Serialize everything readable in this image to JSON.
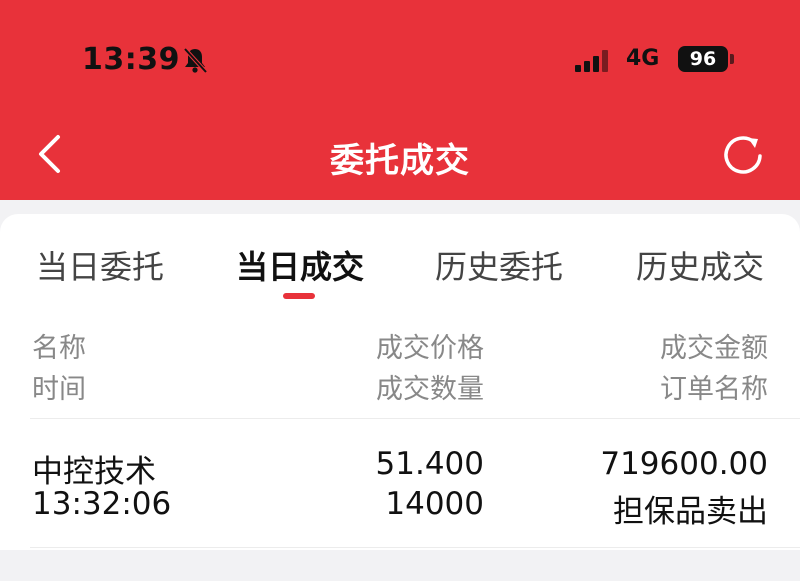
{
  "status_bar": {
    "time": "13:39",
    "network": "4G",
    "battery": "96",
    "icons": [
      "bell-slash-icon",
      "cellular-signal-icon",
      "battery-icon"
    ]
  },
  "nav": {
    "title": "委托成交",
    "icons": [
      "chevron-left-icon",
      "refresh-icon"
    ]
  },
  "tabs": [
    {
      "label": "当日委托",
      "active": false
    },
    {
      "label": "当日成交",
      "active": true
    },
    {
      "label": "历史委托",
      "active": false
    },
    {
      "label": "历史成交",
      "active": false
    }
  ],
  "table": {
    "headers": {
      "col1": [
        "名称",
        "时间"
      ],
      "col2": [
        "成交价格",
        "成交数量"
      ],
      "col3": [
        "成交金额",
        "订单名称"
      ]
    },
    "rows": [
      {
        "name": "中控技术",
        "time": "13:32:06",
        "price": "51.400",
        "quantity": "14000",
        "amount": "719600.00",
        "order_name": "担保品卖出"
      }
    ]
  },
  "colors": {
    "accent": "#e8323a",
    "muted_text": "#888888",
    "background": "#f2f2f4"
  }
}
